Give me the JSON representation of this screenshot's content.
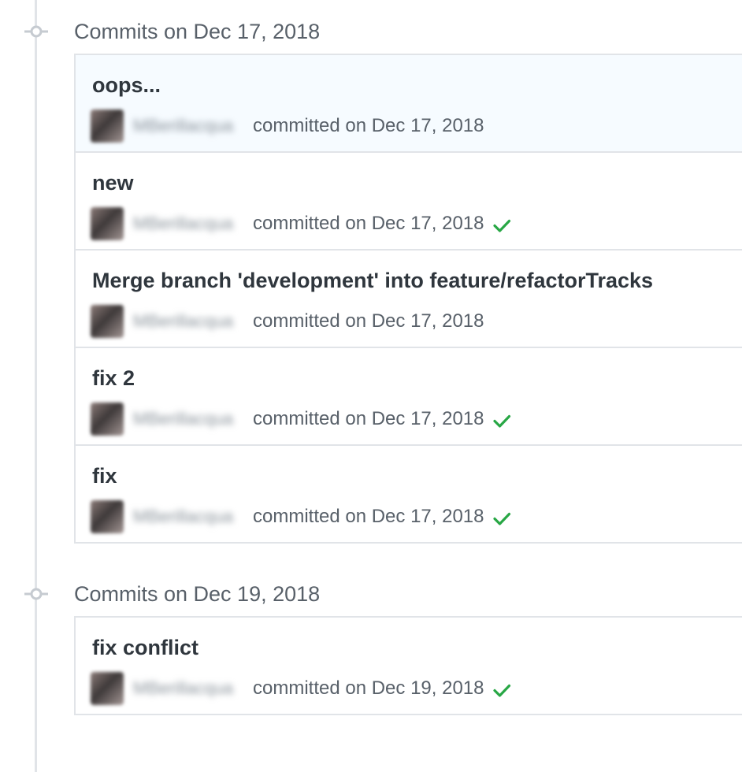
{
  "colors": {
    "success": "#28a745",
    "border": "#e1e4e8",
    "highlight_bg": "#f6fbff",
    "muted_text": "#586069"
  },
  "groups": [
    {
      "title": "Commits on Dec 17, 2018",
      "commits": [
        {
          "message": "oops...",
          "status": "committed on Dec 17, 2018",
          "verified_check": false,
          "highlighted": true
        },
        {
          "message": "new",
          "status": "committed on Dec 17, 2018",
          "verified_check": true,
          "highlighted": false
        },
        {
          "message": "Merge branch 'development' into feature/refactorTracks",
          "status": "committed on Dec 17, 2018",
          "verified_check": false,
          "highlighted": false
        },
        {
          "message": "fix 2",
          "status": "committed on Dec 17, 2018",
          "verified_check": true,
          "highlighted": false
        },
        {
          "message": "fix",
          "status": "committed on Dec 17, 2018",
          "verified_check": true,
          "highlighted": false
        }
      ]
    },
    {
      "title": "Commits on Dec 19, 2018",
      "commits": [
        {
          "message": "fix conflict",
          "status": "committed on Dec 19, 2018",
          "verified_check": true,
          "highlighted": false
        }
      ]
    }
  ],
  "icons": {
    "timeline_node": "git-commit-icon",
    "check": "check-icon"
  }
}
